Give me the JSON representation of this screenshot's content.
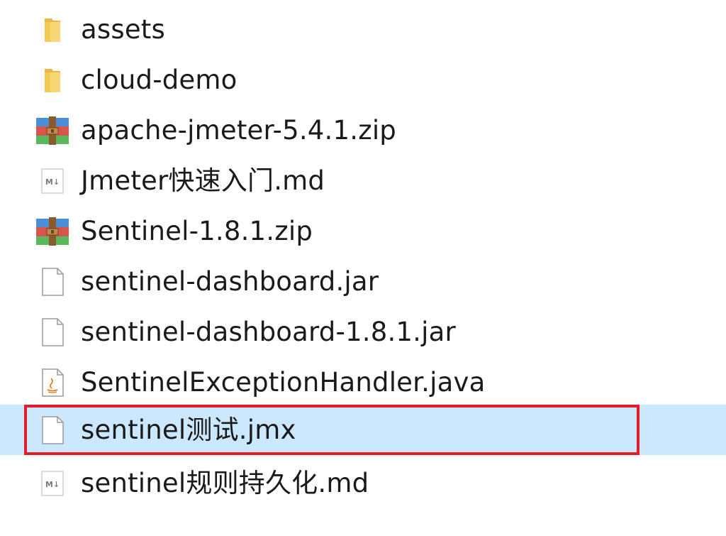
{
  "files": [
    {
      "name": "assets",
      "icon": "folder-icon"
    },
    {
      "name": "cloud-demo",
      "icon": "folder-icon"
    },
    {
      "name": "apache-jmeter-5.4.1.zip",
      "icon": "zip-archive-icon"
    },
    {
      "name": "Jmeter快速入门.md",
      "icon": "markdown-file-icon"
    },
    {
      "name": "Sentinel-1.8.1.zip",
      "icon": "zip-archive-icon"
    },
    {
      "name": "sentinel-dashboard.jar",
      "icon": "blank-file-icon"
    },
    {
      "name": "sentinel-dashboard-1.8.1.jar",
      "icon": "blank-file-icon"
    },
    {
      "name": "SentinelExceptionHandler.java",
      "icon": "java-file-icon"
    },
    {
      "name": "sentinel测试.jmx",
      "icon": "blank-file-icon",
      "selected": true
    },
    {
      "name": "sentinel规则持久化.md",
      "icon": "markdown-file-icon"
    }
  ],
  "colors": {
    "selection_bg": "#cce8ff",
    "highlight_border": "#e11d27",
    "folder": "#f8d775",
    "text": "#1a1a1a"
  }
}
